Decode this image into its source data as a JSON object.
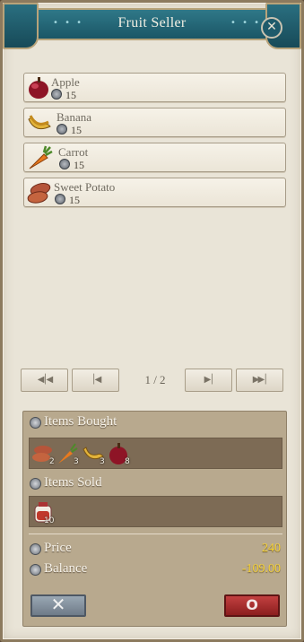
{
  "window": {
    "title": "Fruit Seller",
    "title_dots": "• • •"
  },
  "items": [
    {
      "name": "Apple",
      "price": "15",
      "icon": "apple-icon"
    },
    {
      "name": "Banana",
      "price": "15",
      "icon": "banana-icon"
    },
    {
      "name": "Carrot",
      "price": "15",
      "icon": "carrot-icon"
    },
    {
      "name": "Sweet Potato",
      "price": "15",
      "icon": "sweet-potato-icon"
    }
  ],
  "pager": {
    "page_label": "1 / 2",
    "first_glyph": "◀│◀",
    "prev_glyph": "│◀",
    "next_glyph": "▶│",
    "last_glyph": "▶▶│"
  },
  "summary": {
    "items_bought_label": "Items Bought",
    "items_sold_label": "Items Sold",
    "price_label": "Price",
    "price_value": "240",
    "balance_label": "Balance",
    "balance_value": "-109.00",
    "bought": [
      {
        "icon": "sweet-potato-icon",
        "count": "2"
      },
      {
        "icon": "carrot-icon",
        "count": "3"
      },
      {
        "icon": "banana-icon",
        "count": "3"
      },
      {
        "icon": "apple-icon",
        "count": "8"
      }
    ],
    "sold": [
      {
        "icon": "potion-jar-icon",
        "count": "10"
      }
    ]
  },
  "buttons": {
    "cancel_glyph": "✕",
    "confirm_glyph": "O"
  },
  "colors": {
    "accent_title": "#1b5666",
    "value_gold": "#f5d23a",
    "confirm_red": "#8b1e1e"
  }
}
